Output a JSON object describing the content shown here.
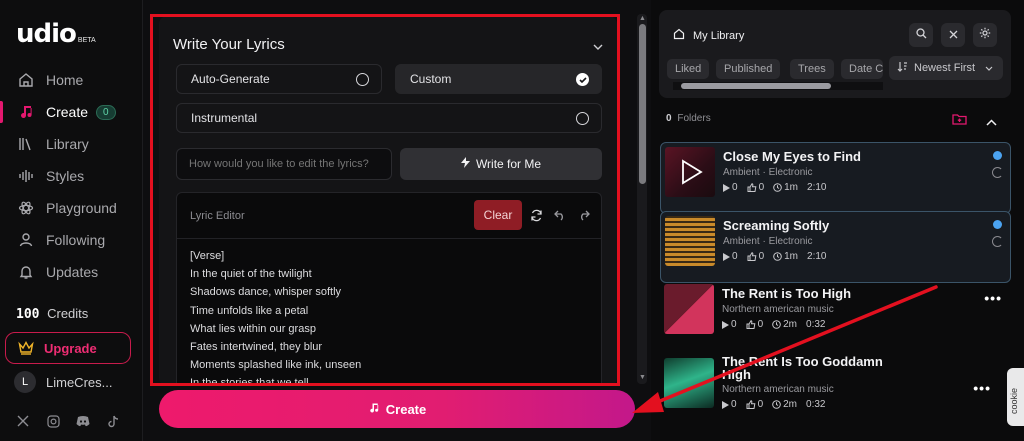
{
  "brand": {
    "name": "udio",
    "tag": "BETA"
  },
  "sidebar": {
    "items": [
      {
        "label": "Home",
        "icon": "home-icon"
      },
      {
        "label": "Create",
        "icon": "music-note-icon",
        "badge": "0"
      },
      {
        "label": "Library",
        "icon": "library-icon"
      },
      {
        "label": "Styles",
        "icon": "waveform-icon"
      },
      {
        "label": "Playground",
        "icon": "atom-icon"
      },
      {
        "label": "Following",
        "icon": "person-icon"
      },
      {
        "label": "Updates",
        "icon": "bell-icon"
      }
    ],
    "credits_value": "100",
    "credits_label": "Credits",
    "upgrade_label": "Upgrade",
    "user_initial": "L",
    "user_name": "LimeCres..."
  },
  "lyrics": {
    "title": "Write Your Lyrics",
    "options": {
      "auto_generate": "Auto-Generate",
      "custom": "Custom",
      "instrumental": "Instrumental"
    },
    "selected_option": "Custom",
    "edit_placeholder": "How would you like to edit the lyrics?",
    "write_button": "Write for Me",
    "editor_label": "Lyric Editor",
    "clear_button": "Clear",
    "lines": [
      "[Verse]",
      "In the quiet of the twilight",
      "Shadows dance, whisper softly",
      "Time unfolds like a petal",
      "What lies within our grasp",
      "Fates intertwined, they blur",
      "Moments splashed like ink, unseen",
      "In the stories that we tell"
    ]
  },
  "create_button": "Create",
  "library": {
    "title": "My Library",
    "filters": [
      "Liked",
      "Published",
      "Trees",
      "Date C"
    ],
    "sort_label": "Newest First",
    "folders_count": "0",
    "folders_label": "Folders",
    "tracks": [
      {
        "title": "Close My Eyes to Find",
        "sub": "Ambient  ·  Electronic",
        "plays": "0",
        "likes": "0",
        "age": "1m",
        "duration": "2:10"
      },
      {
        "title": "Screaming Softly",
        "sub": "Ambient  ·  Electronic",
        "plays": "0",
        "likes": "0",
        "age": "1m",
        "duration": "2:10"
      },
      {
        "title": "The Rent is Too High",
        "sub": "Northern american music",
        "plays": "0",
        "likes": "0",
        "age": "2m",
        "duration": "0:32"
      },
      {
        "title": "The Rent Is Too Goddamn High",
        "sub": "Northern american music",
        "plays": "0",
        "likes": "0",
        "age": "2m",
        "duration": "0:32"
      }
    ]
  },
  "cookie_tab": "cookie",
  "colors": {
    "accent": "#ee1a6c",
    "annotation_red": "#e3101f",
    "selection_blue": "#4ba3f0"
  }
}
